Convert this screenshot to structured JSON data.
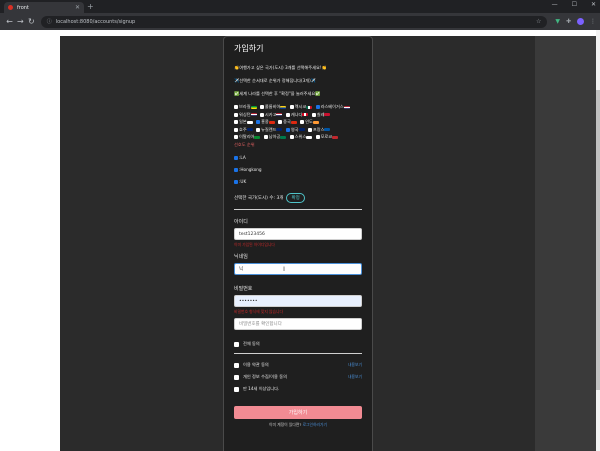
{
  "browser": {
    "tab_title": "front",
    "url": "localhost:8080/accounts/signup"
  },
  "card": {
    "title": "가입하기",
    "notice_lines": [
      "👏여행가고 싶은 국가(도시) 3개를 선택해주세요!👏",
      "✈️선택한 순서대로 순위가 정해집니다(3개)✈️",
      "✅세계 나라를 선택한 후 \"확정\"을 눌러주세요✅"
    ],
    "countries": [
      [
        "브라질",
        "콜롬비아",
        "멕시코",
        "라스베이거스"
      ],
      [
        "워싱턴",
        "시카고",
        "캐나다",
        "칠레"
      ],
      [
        "일본",
        "홍콩",
        "중국",
        "인도"
      ],
      [
        "호주",
        "뉴질랜드",
        "영국",
        "프랑스"
      ],
      [
        "이탈리아",
        "남아공",
        "스위스",
        "모로코"
      ]
    ],
    "extra_item": "선호도 순위",
    "selected": [
      ":LA",
      ":Hongkong",
      ":UK"
    ],
    "selected_count_label": "선택한 국가(도시) 수: 3개",
    "confirm_label": "확정",
    "id_label": "아이디",
    "id_value": "test123456",
    "id_error": "이미 가입된 아이디입니다",
    "nickname_label": "닉네임",
    "nickname_value": "닉",
    "password_label": "비밀번호",
    "password_value": "•••••••",
    "password_error": "비밀번호 형식에 맞지 않습니다",
    "password_confirm_placeholder": "비밀번호를 확인합니다",
    "agree_all_label": "전체 동의",
    "terms": [
      {
        "label": "이용 약관 동의",
        "view": "내용보기"
      },
      {
        "label": "개인 정보 수집/이용 동의",
        "view": "내용보기"
      },
      {
        "label": "만 14세 이상입니다.",
        "view": ""
      }
    ],
    "submit_label": "가입하기",
    "login_prefix": "이미 계정이 있다면?",
    "login_link": "로그인하러가기"
  },
  "colors": {
    "accent": "#4fc3c8",
    "submit": "#f28b93",
    "error": "#c62828",
    "checked": "#1a73e8"
  }
}
